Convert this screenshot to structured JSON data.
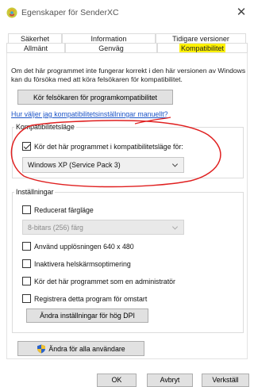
{
  "window": {
    "title": "Egenskaper för SenderXC",
    "icon": "app-icon",
    "close_icon": "close-icon"
  },
  "tabs": {
    "row1": [
      "Säkerhet",
      "Information",
      "Tidigare versioner"
    ],
    "row2": [
      "Allmänt",
      "Genväg",
      "Kompatibilitet"
    ],
    "active": "Kompatibilitet",
    "highlight_color": "#fff200"
  },
  "main": {
    "description": "Om det här programmet inte fungerar korrekt i den här versionen av Windows kan du försöka med att köra felsökaren för kompatibilitet.",
    "troubleshooter_button": "Kör felsökaren för programkompatibilitet",
    "manual_link": "Hur väljer jag kompatibilitetsinställningar manuellt?"
  },
  "compat_mode": {
    "legend": "Kompatibilitetsläge",
    "checkbox_label": "Kör det här programmet i kompatibilitetsläge för:",
    "checked": true,
    "selected_os": "Windows XP (Service Pack 3)",
    "annotation_color": "#e02020"
  },
  "settings": {
    "legend": "Inställningar",
    "reduced_color_label": "Reducerat färgläge",
    "color_select_value": "8-bitars (256) färg",
    "resolution_label": "Använd upplösningen 640 x 480",
    "fullscreen_label": "Inaktivera helskärmsoptimering",
    "admin_label": "Kör det här programmet som en administratör",
    "restart_label": "Registrera detta program för omstart",
    "dpi_button": "Ändra inställningar för hög DPI"
  },
  "all_users_button": "Ändra för alla användare",
  "footer": {
    "ok": "OK",
    "cancel": "Avbryt",
    "apply": "Verkställ"
  }
}
